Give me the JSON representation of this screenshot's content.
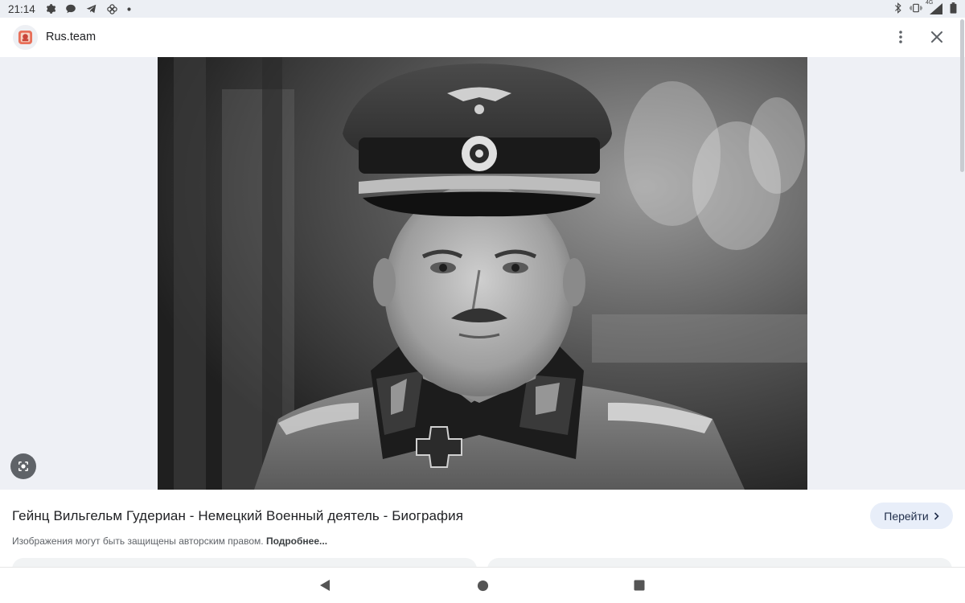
{
  "status_bar": {
    "time": "21:14",
    "left_icons": [
      "settings-icon",
      "chat-bubble-icon",
      "telegram-icon",
      "pinwheel-icon",
      "dot-icon"
    ],
    "right_icons": [
      "bluetooth-icon",
      "vibrate-icon",
      "signal-4g-icon",
      "battery-icon"
    ],
    "network_label": "4G"
  },
  "header": {
    "site_name": "Rus.team",
    "favicon": "site-favicon",
    "more_icon": "more-vert-icon",
    "close_icon": "close-icon"
  },
  "image": {
    "alt": "Гейнц Вильгельм Гудериан",
    "lens_icon": "google-lens-icon"
  },
  "result": {
    "title": "Гейнц Вильгельм Гудериан - Немецкий Военный деятель - Биография",
    "visit_label": "Перейти",
    "copyright_text": "Изображения могут быть защищены авторским правом.",
    "more_link": "Подробнее..."
  },
  "colors": {
    "accent_button_bg": "#e8eef9",
    "stage_bg": "#eef0f5",
    "status_bar_bg": "#eceff4"
  },
  "nav": {
    "back_icon": "back-triangle-icon",
    "home_icon": "home-circle-icon",
    "recents_icon": "recents-square-icon"
  }
}
